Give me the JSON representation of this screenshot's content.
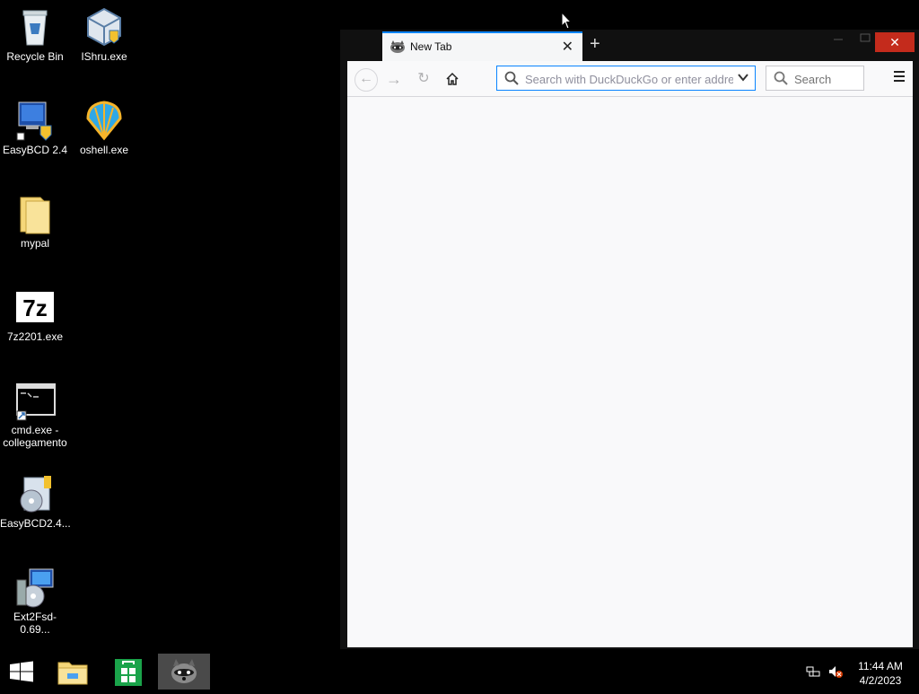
{
  "desktop": {
    "icons": [
      {
        "label": "Recycle Bin"
      },
      {
        "label": "IShru.exe"
      },
      {
        "label": "EasyBCD 2.4"
      },
      {
        "label": "oshell.exe"
      },
      {
        "label": "mypal"
      },
      {
        "label": "7z2201.exe"
      },
      {
        "label": "cmd.exe -\ncollegamento"
      },
      {
        "label": "EasyBCD2.4..."
      },
      {
        "label": "Ext2Fsd-0.69..."
      }
    ]
  },
  "browser": {
    "tab_title": "New Tab",
    "tab_close": "✕",
    "new_tab": "+",
    "window_close": "✕",
    "urlbar_placeholder": "Search with DuckDuckGo or enter address",
    "searchbar_placeholder": "Search"
  },
  "taskbar": {
    "clock_time": "11:44 AM",
    "clock_date": "4/2/2023"
  },
  "colors": {
    "accent": "#0a84ff",
    "close_red": "#c42b1c",
    "content_bg": "#f9f9fa"
  }
}
